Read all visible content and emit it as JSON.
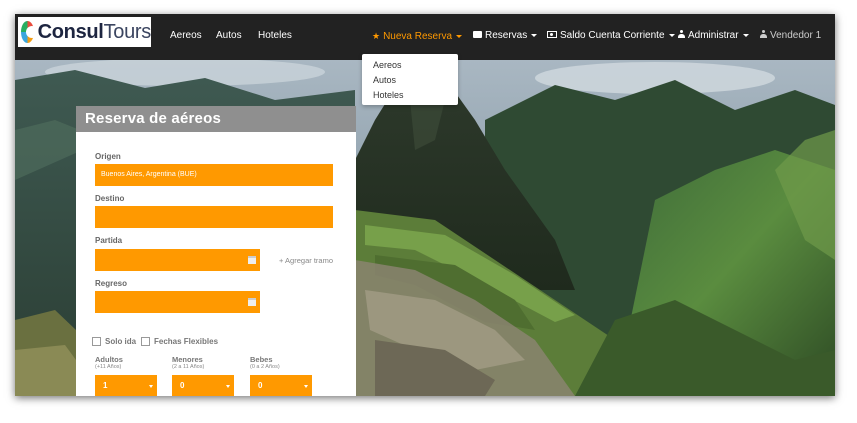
{
  "brand": {
    "name_bold": "Consul",
    "name_light": "Tours"
  },
  "nav": {
    "links": [
      "Aereos",
      "Autos",
      "Hoteles"
    ],
    "nueva_reserva": "Nueva Reserva",
    "reservas": "Reservas",
    "saldo": "Saldo Cuenta Corriente",
    "administrar": "Administrar",
    "user": "Vendedor 1"
  },
  "dropdown": {
    "items": [
      "Aereos",
      "Autos",
      "Hoteles"
    ]
  },
  "form": {
    "title": "Reserva de aéreos",
    "origen_label": "Origen",
    "origen_value": "Buenos Aires, Argentina (BUE)",
    "destino_label": "Destino",
    "destino_value": "",
    "partida_label": "Partida",
    "regreso_label": "Regreso",
    "add_tramo": "+ Agregar tramo",
    "solo_ida": "Solo ida",
    "fechas_flexibles": "Fechas Flexibles",
    "adultos_label": "Adultos",
    "adultos_sub": "(+11 Años)",
    "adultos_value": "1",
    "menores_label": "Menores",
    "menores_sub": "(2 a 11 Años)",
    "menores_value": "0",
    "bebes_label": "Bebes",
    "bebes_sub": "(0 a 2 Años)",
    "bebes_value": "0"
  },
  "colors": {
    "navbar": "#222222",
    "accent": "#ff9900",
    "panel_header": "#8f8f8f"
  }
}
